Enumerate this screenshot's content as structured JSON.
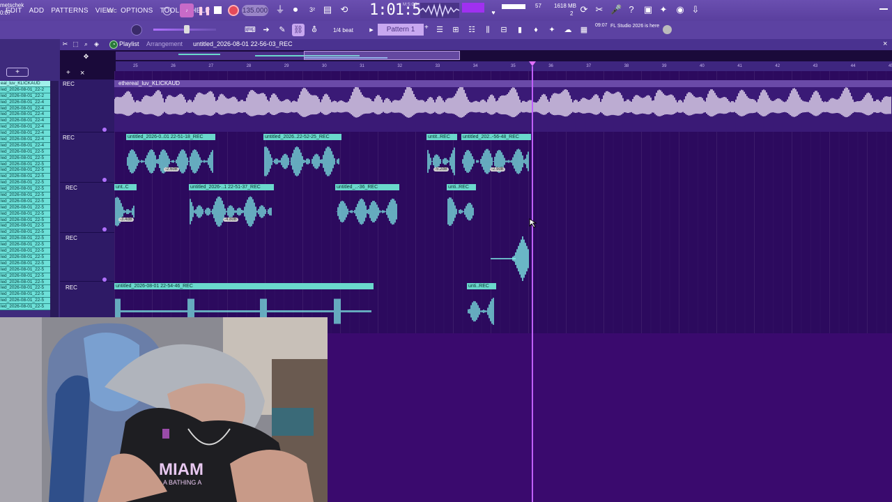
{
  "menu": [
    "EDIT",
    "ADD",
    "PATTERNS",
    "VIEW",
    "OPTIONS",
    "TOOLS",
    "HELP"
  ],
  "transport": {
    "tempo": "135.000",
    "time": "1:01:54",
    "time_unit": "M:S:CS",
    "mem_cpu": "57",
    "mem_mb": "1618 MB",
    "mem_2": "2"
  },
  "hint": {
    "name": "metschek",
    "time": "0:07",
    "rec": "REC"
  },
  "toolbar2": {
    "snap": "1/4 beat",
    "pattern": "Pattern 1",
    "pattern_add": "+",
    "news_time": "09:07",
    "news_text": "FL Studio 2026 is here"
  },
  "playlist": {
    "title": "Playlist",
    "mode": "Arrangement",
    "file": "untitled_2026-08-01 22-56-03_REC"
  },
  "timeline_bars": [
    "25",
    "26",
    "27",
    "28",
    "29",
    "30",
    "31",
    "32",
    "33",
    "34",
    "35",
    "36",
    "37",
    "38",
    "39",
    "40",
    "41",
    "42",
    "43",
    "44",
    "45"
  ],
  "browser_picks": [
    "eal_luv_KLICKAUD",
    "led_2026-08-01_22-2",
    "led_2026-08-01_22-2",
    "led_2026-08-01_22-4",
    "led_2026-08-01_22-4",
    "led_2026-08-01_22-4",
    "led_2026-08-01_22-4",
    "led_2026-08-01_22-4",
    "led_2026-08-01_22-4",
    "led_2026-08-01_22-4",
    "led_2026-08-01_22-4",
    "led_2026-08-01_22-5",
    "led_2026-08-01_22-5",
    "led_2026-08-01_22-5",
    "led_2026-08-01_22-5",
    "led_2026-08-01_22-5",
    "led_2026-08-01_22-5",
    "led_2026-08-01_22-5",
    "led_2026-08-01_22-5",
    "led_2026-08-01_22-5",
    "led_2026-08-01_22-5",
    "led_2026-08-01_22-5",
    "led_2026-08-01_22-5",
    "led_2026-08-01_22-5",
    "led_2026-08-01_22-5",
    "led_2026-08-01_22-5",
    "led_2026-08-01_22-5",
    "led_2026-08-01_22-5",
    "led_2026-08-01_22-5",
    "led_2026-08-01_22-5",
    "led_2026-08-01_22-5",
    "led_2026-08-01_22-5",
    "led_2026-08-01_22-5",
    "led_2026-08-01_22-5",
    "led_2026-08-01_22-5",
    "led_2026-08-01_22-5",
    "led_2026-08-01_22-5"
  ],
  "tracks": [
    {
      "label": "REC"
    },
    {
      "label": "REC"
    },
    {
      "label": "REC"
    },
    {
      "label": "REC"
    },
    {
      "label": "REC"
    }
  ],
  "main_clip": "ethereal_luv_KLICKAUD",
  "clips": [
    {
      "name": "untitled_2026-0..01 22-51-18_REC",
      "db": "-2.6dB"
    },
    {
      "name": "untitled_2026..22-52-25_REC",
      "db": ""
    },
    {
      "name": "untit..REC",
      "db": "-5.2dB"
    },
    {
      "name": "untitled_202..-56-48_REC",
      "db": "-2.9dB"
    },
    {
      "name": "unt..C",
      "db": "-3.4dB"
    },
    {
      "name": "untitled_2026-..1 22-51-37_REC",
      "db": "-4.8dB"
    },
    {
      "name": "untitled_..-36_REC",
      "db": ""
    },
    {
      "name": "unti..REC",
      "db": ""
    },
    {
      "name": "untitled_2026-08-01 22-54-46_REC",
      "db": ""
    },
    {
      "name": "unti..REC",
      "db": ""
    }
  ],
  "webcam": {
    "shirt_text": "MIAM",
    "shirt_sub": "A BATHING A"
  },
  "colors": {
    "accent": "#c060ff",
    "clip": "#6ad8cc",
    "record": "#e64a5a"
  }
}
